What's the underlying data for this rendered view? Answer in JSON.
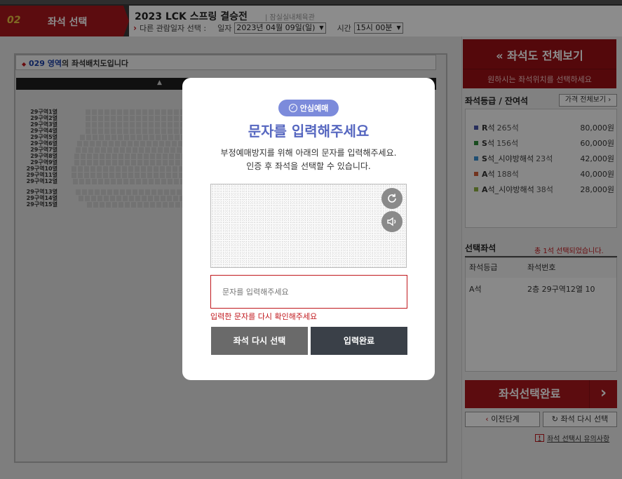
{
  "header": {
    "step_number": "02",
    "step_title": "좌석 선택",
    "event_title": "2023 LCK 스프링 결승전",
    "venue": "| 잠실실내체육관",
    "other_date_label": "다른 관람일자 선택 :",
    "date_label": "일자",
    "date_value": "2023년 04월 09일(일)",
    "time_label": "시간",
    "time_value": "15시 00분"
  },
  "seat_map": {
    "zone": "029 영역",
    "zone_suffix": "의 좌석배치도입니다",
    "stage_glyph": "▲",
    "rows": [
      "29구역1열",
      "29구역2열",
      "29구역3열",
      "29구역4열",
      "29구역5열",
      "29구역6열",
      "29구역7열",
      "29구역8열",
      "29구역9열",
      "29구역10열",
      "29구역11열",
      "29구역12열",
      "29구역13열",
      "29구역14열",
      "29구역15열"
    ]
  },
  "side": {
    "full_view_title": "좌석도 전체보기",
    "full_view_sub": "원하시는 좌석위치를 선택하세요",
    "grade_heading": "좌석등급 / 잔여석",
    "price_all_button": "가격 전체보기",
    "grades": [
      {
        "letter": "R",
        "rest": "석",
        "count": "265석",
        "price": "80,000원",
        "color": "#4a56a8"
      },
      {
        "letter": "S",
        "rest": "석",
        "count": "156석",
        "price": "60,000원",
        "color": "#2e8b3a"
      },
      {
        "letter": "S",
        "rest": "석_시야방해석",
        "count": "23석",
        "price": "42,000원",
        "color": "#3a8fd0"
      },
      {
        "letter": "A",
        "rest": "석",
        "count": "188석",
        "price": "40,000원",
        "color": "#d0603a"
      },
      {
        "letter": "A",
        "rest": "석_시야방해석",
        "count": "38석",
        "price": "28,000원",
        "color": "#8db040"
      }
    ],
    "selected_heading": "선택좌석",
    "selected_count": "총 1석 선택되었습니다.",
    "col_grade": "좌석등급",
    "col_seat": "좌석번호",
    "selected_grade": "A석",
    "selected_seat": "2층 29구역12열 10",
    "complete_button": "좌석선택완료",
    "prev_button": "이전단계",
    "reselect_button": "좌석 다시 선택",
    "notice_link": "좌석 선택시 유의사항"
  },
  "modal": {
    "badge": "안심예매",
    "title": "문자를 입력해주세요",
    "desc_line1": "부정예매방지를 위해 아래의 문자를 입력해주세요.",
    "desc_line2": "인증 후 좌석을 선택할 수 있습니다.",
    "input_placeholder": "문자를 입력해주세요",
    "error": "입력한 문자를 다시 확인해주세요",
    "reselect_button": "좌석 다시 선택",
    "submit_button": "입력완료"
  }
}
